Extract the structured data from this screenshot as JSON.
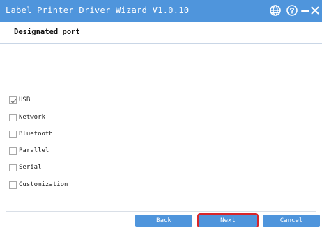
{
  "window": {
    "title": "Label Printer Driver Wizard  V1.0.10",
    "icons": [
      "globe-icon",
      "help-icon",
      "minimize-icon",
      "close-icon"
    ],
    "accent_color": "#4f95dc",
    "highlight_color": "#d9262b"
  },
  "page": {
    "subtitle": "Designated port"
  },
  "ports": [
    {
      "label": "USB",
      "checked": true
    },
    {
      "label": "Network",
      "checked": false
    },
    {
      "label": "Bluetooth",
      "checked": false
    },
    {
      "label": "Parallel",
      "checked": false
    },
    {
      "label": "Serial",
      "checked": false
    },
    {
      "label": "Customization",
      "checked": false
    }
  ],
  "buttons": {
    "back": "Back",
    "next": "Next",
    "cancel": "Cancel"
  }
}
